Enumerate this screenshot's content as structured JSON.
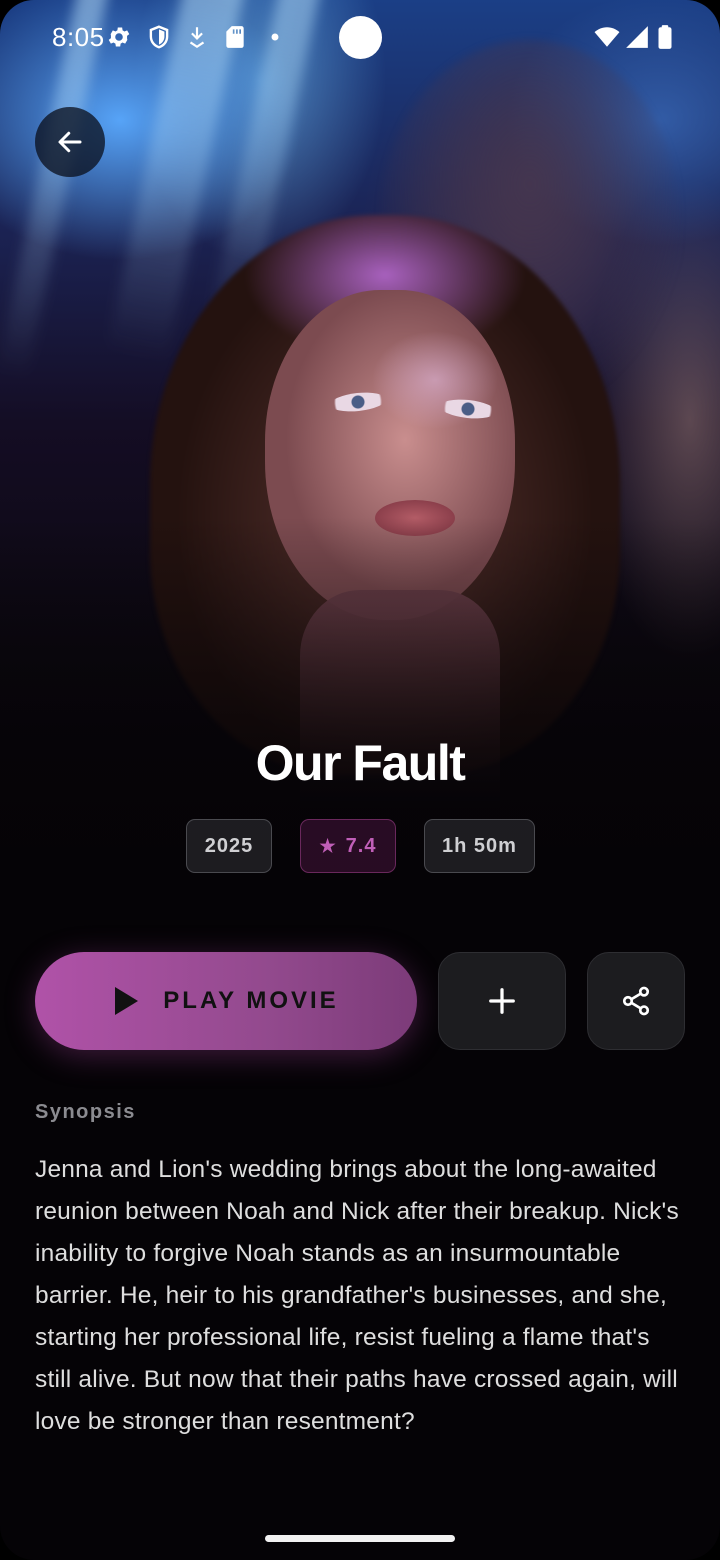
{
  "status_bar": {
    "time": "8:05",
    "left_icons": [
      "gear-icon",
      "shield-icon",
      "download-icon",
      "sd-card-icon",
      "dot-icon"
    ],
    "right_icons": [
      "wifi-icon",
      "signal-icon",
      "battery-icon"
    ]
  },
  "movie": {
    "title": "Our Fault",
    "year": "2025",
    "rating": "7.4",
    "rating_icon": "star-icon",
    "duration": "1h 50m"
  },
  "actions": {
    "play_label": "PLAY MOVIE",
    "play_icon": "play-icon",
    "add_icon": "plus-icon",
    "share_icon": "share-icon",
    "back_icon": "arrow-left-icon"
  },
  "synopsis": {
    "label": "Synopsis",
    "text": "Jenna and Lion's wedding brings about the long-awaited reunion between Noah and Nick after their breakup. Nick's inability to forgive Noah stands as an insurmountable barrier. He, heir to his grandfather's businesses, and she, starting her professional life, resist fueling a flame that's still alive. But now that their paths have crossed again, will love be stronger than resentment?"
  },
  "colors": {
    "accent": "#b052a8",
    "rating": "#c05fb8",
    "background": "#050306"
  }
}
